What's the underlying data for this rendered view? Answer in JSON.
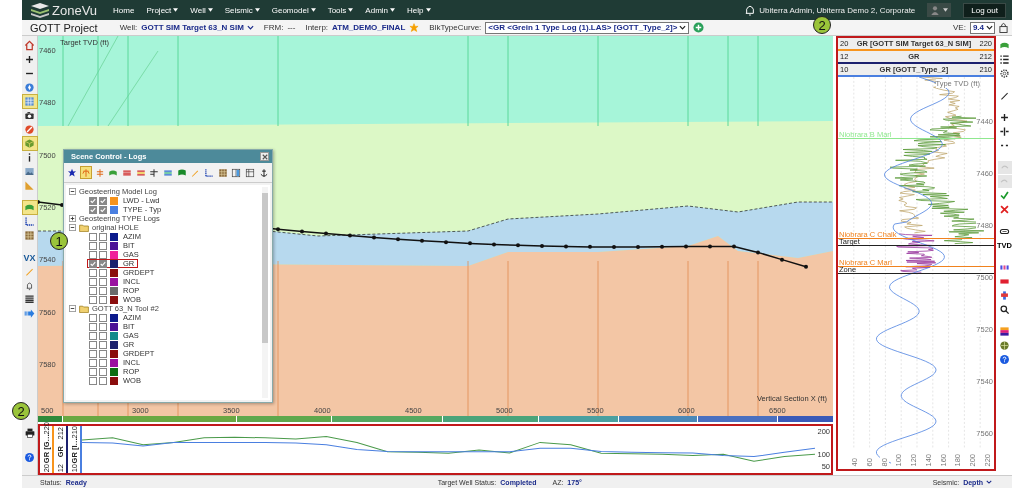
{
  "nav": {
    "logo": "ZoneVu",
    "menu": [
      {
        "label": "Home",
        "dropdown": false
      },
      {
        "label": "Project",
        "dropdown": true
      },
      {
        "label": "Well",
        "dropdown": true
      },
      {
        "label": "Seismic",
        "dropdown": true
      },
      {
        "label": "Geomodel",
        "dropdown": true
      },
      {
        "label": "Tools",
        "dropdown": true
      },
      {
        "label": "Admin",
        "dropdown": true
      },
      {
        "label": "Help",
        "dropdown": true
      }
    ],
    "user": "Ubiterra Admin, Ubiterra Demo 2, Corporate",
    "logout": "Log out"
  },
  "toolbar": {
    "project": "GOTT Project",
    "well_label": "Well:",
    "well": "GOTT SIM Target 63_N SIM",
    "frm_label": "FRM:",
    "frm": "---",
    "interp_label": "Interp:",
    "interp": "ATM_DEMO_FINAL",
    "favorite": true,
    "typecurve_label": "BlkTypeCurve:",
    "typecurve": "<GR <Grein 1 Type Log (1).LAS> [GOTT_Type_2]>",
    "ve_label": "VE:",
    "ve": "9.4"
  },
  "left_toolbar": [
    {
      "selected": false
    },
    {
      "selected": false
    },
    {
      "selected": false
    },
    {
      "selected": false
    },
    {
      "selected": true
    },
    {
      "selected": false
    },
    {
      "selected": false
    },
    {
      "selected": true
    },
    {
      "selected": false
    },
    {
      "selected": false
    },
    {
      "selected": false
    },
    {
      "selected": true
    },
    {
      "selected": false
    },
    {
      "selected": false
    },
    {
      "selected": false,
      "label": "VX"
    },
    {
      "selected": false
    },
    {
      "selected": false
    },
    {
      "selected": false
    },
    {
      "selected": false
    }
  ],
  "section": {
    "y_title": "Target TVD (ft)",
    "y_ticks": [
      "7460",
      "7480",
      "7500",
      "7520",
      "7540",
      "7560",
      "7580"
    ],
    "x_title": "Vertical Section X (ft)",
    "x_ticks": [
      "500",
      "3000",
      "3500",
      "4000",
      "4500",
      "5000",
      "5500",
      "6000",
      "6500"
    ]
  },
  "scene_control": {
    "title": "Scene Control - Logs",
    "tools": [
      {
        "selected": false
      },
      {
        "selected": true
      },
      {
        "selected": false
      },
      {
        "selected": false
      },
      {
        "selected": false
      },
      {
        "selected": false
      },
      {
        "selected": false
      },
      {
        "selected": false
      },
      {
        "selected": false
      },
      {
        "selected": false
      },
      {
        "selected": false
      },
      {
        "selected": false
      },
      {
        "selected": false
      },
      {
        "selected": false
      },
      {
        "selected": false
      }
    ],
    "groups": [
      {
        "label": "Geosteering Model Log",
        "expanded": true,
        "folder": false,
        "children": [
          {
            "label": "LWD - Lwd",
            "color": "#f7941d",
            "checked": true,
            "highlighted": false
          },
          {
            "label": "TYPE - Typ",
            "color": "#4a7fe0",
            "checked": true,
            "highlighted": false
          }
        ]
      },
      {
        "label": "Geosteering TYPE Logs",
        "expanded": false,
        "folder": false
      },
      {
        "label": "original HOLE",
        "expanded": true,
        "folder": true,
        "children": [
          {
            "label": "AZIM",
            "color": "#0b1a8c",
            "checked": false,
            "highlighted": false
          },
          {
            "label": "BIT",
            "color": "#4b1296",
            "checked": false,
            "highlighted": false
          },
          {
            "label": "GAS",
            "color": "#f0229a",
            "checked": false,
            "highlighted": false
          },
          {
            "label": "GR",
            "color": "#1c216e",
            "checked": true,
            "highlighted": true
          },
          {
            "label": "GRDEPT",
            "color": "#8a0d0d",
            "checked": false,
            "highlighted": false
          },
          {
            "label": "INCL",
            "color": "#9a12a0",
            "checked": false,
            "highlighted": false
          },
          {
            "label": "ROP",
            "color": "#6a6a6a",
            "checked": false,
            "highlighted": false
          },
          {
            "label": "WOB",
            "color": "#8a0d0d",
            "checked": false,
            "highlighted": false
          }
        ]
      },
      {
        "label": "GOTT 63_N Tool #2",
        "expanded": true,
        "folder": true,
        "children": [
          {
            "label": "AZIM",
            "color": "#0b1a8c",
            "checked": false,
            "highlighted": false
          },
          {
            "label": "BIT",
            "color": "#4b1296",
            "checked": false,
            "highlighted": false
          },
          {
            "label": "GAS",
            "color": "#128a8a",
            "checked": false,
            "highlighted": false
          },
          {
            "label": "GR",
            "color": "#1c216e",
            "checked": false,
            "highlighted": false
          },
          {
            "label": "GRDEPT",
            "color": "#8a0d0d",
            "checked": false,
            "highlighted": false
          },
          {
            "label": "INCL",
            "color": "#9a12a0",
            "checked": false,
            "highlighted": false
          },
          {
            "label": "ROP",
            "color": "#0d6e12",
            "checked": false,
            "highlighted": false
          },
          {
            "label": "WOB",
            "color": "#8a0d0d",
            "checked": false,
            "highlighted": false
          }
        ]
      }
    ]
  },
  "log_panel": {
    "headers": [
      {
        "min": "20",
        "name": "GR [GOTT SIM Target 63_N SIM]",
        "max": "220",
        "color": "#f7941d"
      },
      {
        "min": "12",
        "name": "GR",
        "max": "212",
        "color": "#1c216e"
      },
      {
        "min": "10",
        "name": "GR [GOTT_Type_2]",
        "max": "210",
        "color": "#4a7fe0"
      }
    ],
    "title": "Type TVD (ft)",
    "depth_ticks": [
      "7440",
      "7460",
      "7480",
      "7500",
      "7520",
      "7540",
      "7560"
    ],
    "markers": [
      {
        "label": "Niobrara B Marl",
        "color": "#8fe88f"
      },
      {
        "label": "Niobrara C Chalk",
        "color": "#f0821e"
      },
      {
        "label": "Target",
        "color": "#222222"
      },
      {
        "label": "Niobrara C Marl",
        "color": "#f0821e"
      },
      {
        "label": "Zone",
        "color": "#222222"
      }
    ],
    "value_ticks": [
      "40",
      "60",
      "80",
      "100",
      "120",
      "140",
      "160",
      "180",
      "200",
      "220"
    ]
  },
  "right_toolbar": [
    {
      "disabled": false
    },
    {
      "disabled": false
    },
    {
      "disabled": false
    },
    {
      "disabled": false
    },
    {
      "disabled": false
    },
    {
      "disabled": false
    },
    {
      "disabled": false
    },
    {
      "disabled": true
    },
    {
      "disabled": true
    },
    {
      "disabled": false
    },
    {
      "disabled": false
    },
    {
      "disabled": false
    },
    {
      "disabled": false,
      "label": "TVD"
    },
    {
      "disabled": false
    },
    {
      "disabled": false
    },
    {
      "disabled": false
    },
    {
      "disabled": false
    },
    {
      "disabled": false
    },
    {
      "disabled": false
    },
    {
      "disabled": false
    }
  ],
  "strip": {
    "tracks": [
      {
        "min": "20",
        "name": "GR [G…",
        "max": "220",
        "color": "#f7941d"
      },
      {
        "min": "12",
        "name": "GR",
        "max": "212",
        "color": "#1c216e"
      },
      {
        "min": "10",
        "name": "GR [I…",
        "max": "210",
        "color": "#4a7fe0"
      }
    ],
    "chart_data": {
      "type": "line",
      "categories": [
        null,
        null,
        null,
        null,
        null,
        null,
        null,
        null,
        null,
        null,
        null,
        null,
        null,
        null,
        null,
        null,
        null,
        null,
        null,
        null,
        null,
        null,
        null,
        null,
        null
      ],
      "ylim": [
        20,
        220
      ],
      "yticks": [
        200,
        100,
        50
      ],
      "series": [
        {
          "color": "#4a9a4a",
          "values": [
            160,
            170,
            140,
            150,
            170,
            172,
            170,
            165,
            175,
            150,
            110,
            108,
            104,
            118,
            105,
            150,
            140,
            104,
            102,
            100,
            95,
            100,
            70,
            90,
            100
          ]
        },
        {
          "color": "#4a7fe0",
          "values": [
            150,
            148,
            135,
            150,
            150,
            150,
            150,
            148,
            140,
            120,
            112,
            110,
            110,
            110,
            110,
            125,
            125,
            112,
            108,
            106,
            105,
            95,
            90,
            108,
            125
          ]
        }
      ]
    }
  },
  "callouts": [
    "1",
    "2",
    "2"
  ],
  "status": {
    "label": "Status:",
    "value": "Ready",
    "well_label": "Target Well Status:",
    "well_value": "Completed",
    "az_label": "AZ:",
    "az_value": "175°",
    "seismic_label": "Seismic:",
    "seismic_value": "Depth"
  }
}
